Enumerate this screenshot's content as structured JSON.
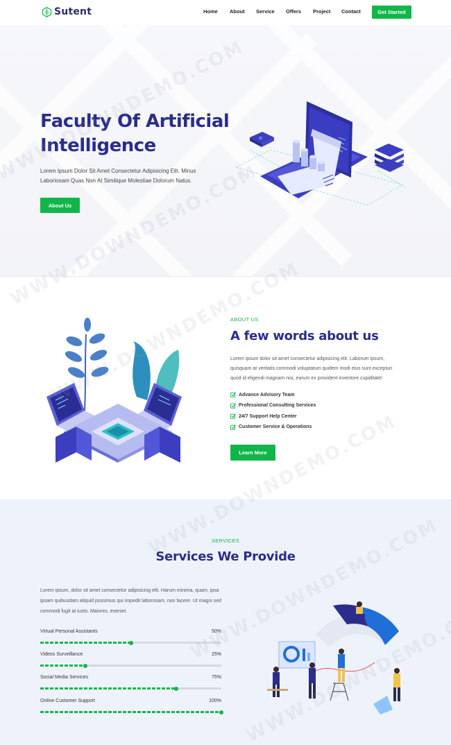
{
  "nav": {
    "brand": "Sutent",
    "links": [
      "Home",
      "About",
      "Service",
      "Offers",
      "Project",
      "Contact"
    ],
    "cta": "Get Started"
  },
  "hero": {
    "title": "Faculty Of Artificial Intelligence",
    "text": "Lorem Ipsum Dolor Sit Amet Consectetur Adipisicing Elit. Minus Laboriosam Quas Non At Similique Molestiae Dolorum Natus.",
    "button": "About Us"
  },
  "about": {
    "eyebrow": "ABOUT US",
    "title": "A few words about us",
    "text": "Lorem ipsum dolor sit amet consectetur adipisicing elit. Laborum ipsum, quisquam at veritatis commodi voluptatum quidem modi eius sunt excepturi quod id eligendi magnam nisi, earum ex provident inventore cupiditate!",
    "checklist": [
      "Advance Advisory Team",
      "Professional Consulting Services",
      "24/7 Support Help Center",
      "Customer Service & Operations"
    ],
    "button": "Learn More"
  },
  "services": {
    "eyebrow": "SERVICES",
    "title": "Services We Provide",
    "text": "Lorem ipsum, dolor sit amet consectetur adipisicing elit. Harum minima, quam, ipsa ipsam quibusdam aliquid possimus qui impedit laborosam, non facere. Ut magni sed commodi fugit at iusto. Maiores, eveniet.",
    "skills": [
      {
        "label": "Virtual Personal Assistants",
        "percent_text": "50%",
        "value": 50
      },
      {
        "label": "Videos Surveillance",
        "percent_text": "25%",
        "value": 25
      },
      {
        "label": "Social Media Services",
        "percent_text": "75%",
        "value": 75
      },
      {
        "label": "Online Customer Support",
        "percent_text": "100%",
        "value": 100
      }
    ]
  },
  "watermark": "WWW.DOWNDEMO.COM",
  "colors": {
    "brand": "#2b2c8c",
    "accent": "#10b64a",
    "services_bg": "#eef3fb"
  },
  "icons": {
    "logo": "hexagon-logo-icon",
    "check": "check-square-icon"
  }
}
